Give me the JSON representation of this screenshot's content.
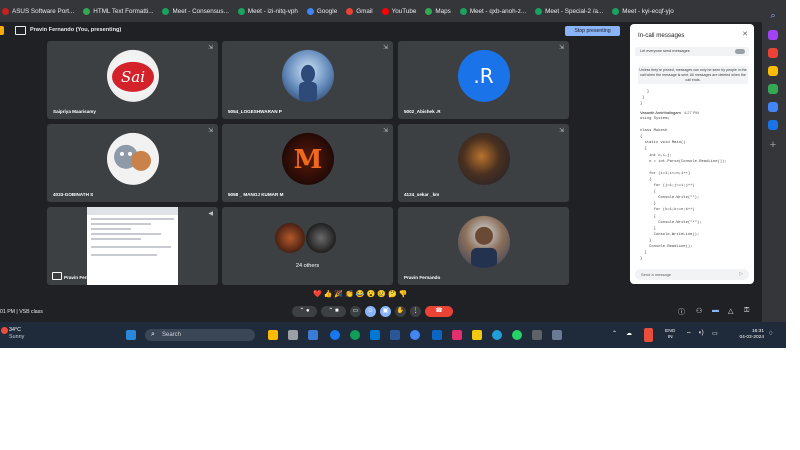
{
  "bookmarks": [
    {
      "label": "ASUS Software Port...",
      "color": "#c5221f"
    },
    {
      "label": "HTML Text Formatti...",
      "color": "#34a853"
    },
    {
      "label": "Meet - Consensus...",
      "color": "#1aa260"
    },
    {
      "label": "Meet - izi-nitq-vph",
      "color": "#1aa260"
    },
    {
      "label": "Google",
      "color": "#4285f4"
    },
    {
      "label": "Gmail",
      "color": "#ea4335"
    },
    {
      "label": "YouTube",
      "color": "#ff0000"
    },
    {
      "label": "Maps",
      "color": "#34a853"
    },
    {
      "label": "Meet - qxb-anoh-z...",
      "color": "#1aa260"
    },
    {
      "label": "Meet - Special-2 /a...",
      "color": "#1aa260"
    },
    {
      "label": "Meet - kyi-ecqf-yjo",
      "color": "#1aa260"
    }
  ],
  "bookmarks_more": ">",
  "meet": {
    "presenter_label": "Pravin Fernando (You, presenting)",
    "stop_button": "Stop presenting",
    "tiles": [
      {
        "name": "Saipriya Maarisamy",
        "avatar": "sai-logo-icon"
      },
      {
        "name": "5054_LOGESHWARAN P",
        "avatar": "shiva-avatar-icon"
      },
      {
        "name": "5002_Abishek .R",
        "avatar": "letter-avatar",
        "initial": ".R"
      },
      {
        "name": "4033-GOBINATH S",
        "avatar": "cartoon-avatar-icon"
      },
      {
        "name": "5058 _ MANOJ KUMAR M",
        "avatar": "letter-m-avatar-icon"
      },
      {
        "name": "4124_sekar _km",
        "avatar": "tiger-avatar-icon"
      },
      {
        "name": "Pravin Fernando",
        "avatar": "screen-share-preview"
      },
      {
        "name": "24 others",
        "avatar": "group-avatars"
      },
      {
        "name": "Pravin Fernando",
        "avatar": "portrait-avatar-icon"
      }
    ],
    "time_label": "01 PM | VSB class"
  },
  "chat": {
    "title": "In-call messages",
    "allow_label": "Let everyone send messages",
    "info": "Unless they're pinned, messages can only be seen by people in the call when the message is sent. All messages are deleted when the call ends.",
    "sender": "Vasanth Amirthalingam",
    "sender_time": "4:27 PM",
    "code_lines": [
      "using System;",
      "",
      "class Mukesh",
      "{",
      "  static void Main()",
      "  {",
      "    int n,i,j;",
      "    n = int.Parse(Console.ReadLine());",
      "",
      "    for (i=1;i<=n;i++)",
      "    {",
      "      for (j=1;j<=i;j++)",
      "      {",
      "        Console.Write(\"\");",
      "      }",
      "      for (k=1;k<=n;k++)",
      "      {",
      "        Console.Write(\"*\");",
      "      }",
      "      Console.WriteLine();",
      "    }",
      "    Console.ReadLine();",
      "  }",
      "}"
    ],
    "send_placeholder": "Send a message"
  },
  "taskbar": {
    "temperature": "34°C",
    "condition": "Sunny",
    "search_label": "Search",
    "lang_top": "ENG",
    "lang_bottom": "IN",
    "clock_time": "16:31",
    "clock_date": "04-03-2024"
  }
}
